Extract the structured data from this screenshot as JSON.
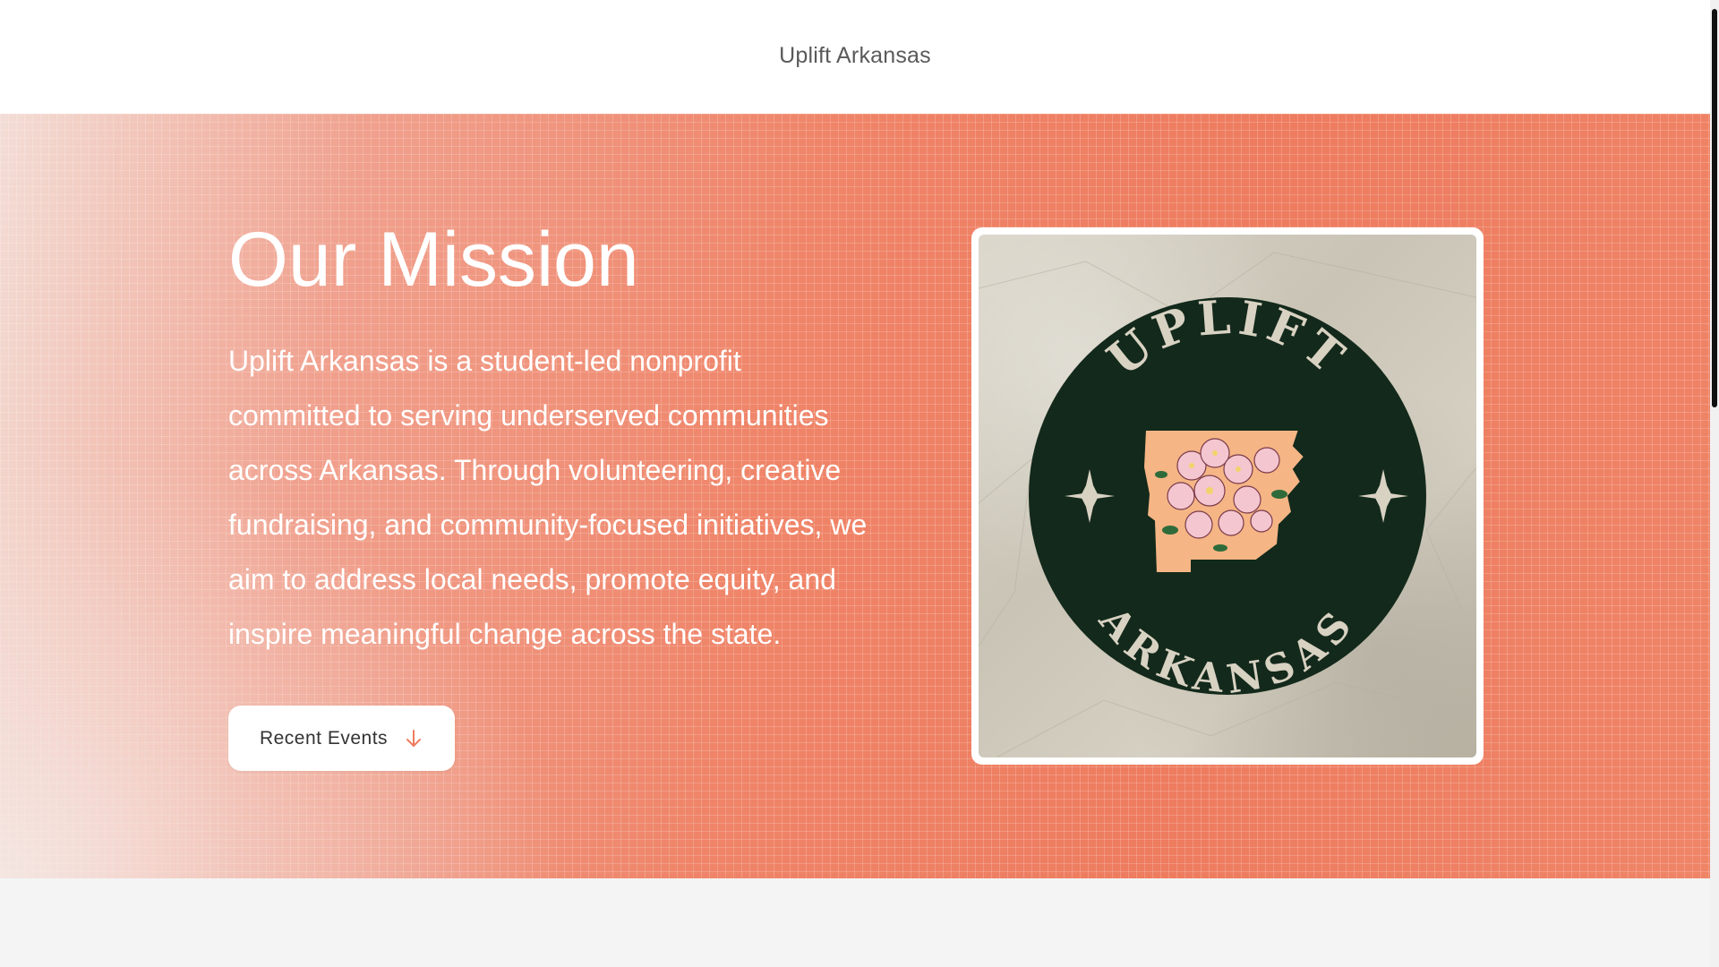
{
  "header": {
    "site_title": "Uplift Arkansas"
  },
  "hero": {
    "heading": "Our Mission",
    "body": "Uplift Arkansas is a student-led nonprofit committed to serving underserved communities across Arkansas. Through volunteering, creative fundraising, and community-focused initiatives, we aim to address local needs, promote equity, and inspire meaningful change across the state.",
    "button_label": "Recent Events",
    "button_icon": "arrow-down-icon"
  },
  "logo": {
    "top_text": "UPLIFT",
    "bottom_text": "ARKANSAS"
  },
  "colors": {
    "accent": "#EE7C5F",
    "logo_green": "#13291B",
    "logo_peach": "#F5B585",
    "logo_pink": "#F4C6D0"
  }
}
